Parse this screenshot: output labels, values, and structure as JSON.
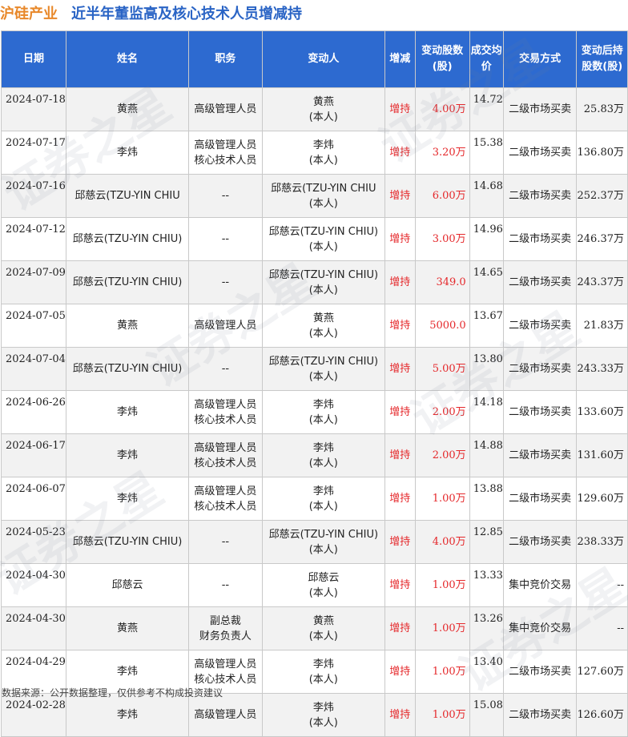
{
  "header": {
    "company": "沪硅产业",
    "title": "近半年董监高及核心技术人员增减持"
  },
  "columns": [
    "日期",
    "姓名",
    "职务",
    "变动人",
    "增减",
    "变动股数(股)",
    "成交均价",
    "交易方式",
    "变动后持股数(股)"
  ],
  "rows": [
    {
      "date": "2024-07-18",
      "name": "黄燕",
      "role": [
        "高级管理人员"
      ],
      "changer": [
        "黄燕",
        "(本人)"
      ],
      "dir": "增持",
      "amount": "4.00万",
      "price": "14.72",
      "method": "二级市场买卖",
      "after": "25.83万"
    },
    {
      "date": "2024-07-17",
      "name": "李炜",
      "role": [
        "高级管理人员",
        "核心技术人员"
      ],
      "changer": [
        "李炜",
        "(本人)"
      ],
      "dir": "增持",
      "amount": "3.20万",
      "price": "15.38",
      "method": "二级市场买卖",
      "after": "136.80万"
    },
    {
      "date": "2024-07-16",
      "name": "邱慈云(TZU-YIN CHIU",
      "role": [
        "--"
      ],
      "changer": [
        "邱慈云(TZU-YIN CHIU",
        "(本人)"
      ],
      "dir": "增持",
      "amount": "6.00万",
      "price": "14.68",
      "method": "二级市场买卖",
      "after": "252.37万"
    },
    {
      "date": "2024-07-12",
      "name": "邱慈云(TZU-YIN CHIU)",
      "role": [
        "--"
      ],
      "changer": [
        "邱慈云(TZU-YIN CHIU)",
        "(本人)"
      ],
      "dir": "增持",
      "amount": "3.00万",
      "price": "14.96",
      "method": "二级市场买卖",
      "after": "246.37万"
    },
    {
      "date": "2024-07-09",
      "name": "邱慈云(TZU-YIN CHIU)",
      "role": [
        "--"
      ],
      "changer": [
        "邱慈云(TZU-YIN CHIU)",
        "(本人)"
      ],
      "dir": "增持",
      "amount": "349.0",
      "price": "14.65",
      "method": "二级市场买卖",
      "after": "243.37万"
    },
    {
      "date": "2024-07-05",
      "name": "黄燕",
      "role": [
        "高级管理人员"
      ],
      "changer": [
        "黄燕",
        "(本人)"
      ],
      "dir": "增持",
      "amount": "5000.0",
      "price": "13.67",
      "method": "二级市场买卖",
      "after": "21.83万"
    },
    {
      "date": "2024-07-04",
      "name": "邱慈云(TZU-YIN CHIU)",
      "role": [
        "--"
      ],
      "changer": [
        "邱慈云(TZU-YIN CHIU)",
        "(本人)"
      ],
      "dir": "增持",
      "amount": "5.00万",
      "price": "13.80",
      "method": "二级市场买卖",
      "after": "243.33万"
    },
    {
      "date": "2024-06-26",
      "name": "李炜",
      "role": [
        "高级管理人员",
        "核心技术人员"
      ],
      "changer": [
        "李炜",
        "(本人)"
      ],
      "dir": "增持",
      "amount": "2.00万",
      "price": "14.18",
      "method": "二级市场买卖",
      "after": "133.60万"
    },
    {
      "date": "2024-06-17",
      "name": "李炜",
      "role": [
        "高级管理人员",
        "核心技术人员"
      ],
      "changer": [
        "李炜",
        "(本人)"
      ],
      "dir": "增持",
      "amount": "2.00万",
      "price": "14.88",
      "method": "二级市场买卖",
      "after": "131.60万"
    },
    {
      "date": "2024-06-07",
      "name": "李炜",
      "role": [
        "高级管理人员",
        "核心技术人员"
      ],
      "changer": [
        "李炜",
        "(本人)"
      ],
      "dir": "增持",
      "amount": "1.00万",
      "price": "13.88",
      "method": "二级市场买卖",
      "after": "129.60万"
    },
    {
      "date": "2024-05-23",
      "name": "邱慈云(TZU-YIN CHIU)",
      "role": [
        "--"
      ],
      "changer": [
        "邱慈云(TZU-YIN CHIU)",
        "(本人)"
      ],
      "dir": "增持",
      "amount": "4.00万",
      "price": "12.85",
      "method": "二级市场买卖",
      "after": "238.33万"
    },
    {
      "date": "2024-04-30",
      "name": "邱慈云",
      "role": [
        "--"
      ],
      "changer": [
        "邱慈云",
        "(本人)"
      ],
      "dir": "增持",
      "amount": "1.00万",
      "price": "13.33",
      "method": "集中竞价交易",
      "after": "--"
    },
    {
      "date": "2024-04-30",
      "name": "黄燕",
      "role": [
        "副总裁",
        "财务负责人"
      ],
      "changer": [
        "黄燕",
        "(本人)"
      ],
      "dir": "增持",
      "amount": "1.00万",
      "price": "13.26",
      "method": "集中竞价交易",
      "after": "--"
    },
    {
      "date": "2024-04-29",
      "name": "李炜",
      "role": [
        "高级管理人员",
        "核心技术人员"
      ],
      "changer": [
        "李炜",
        "(本人)"
      ],
      "dir": "增持",
      "amount": "1.00万",
      "price": "13.40",
      "method": "二级市场买卖",
      "after": "127.60万"
    },
    {
      "date": "2024-02-28",
      "name": "李炜",
      "role": [
        "高级管理人员"
      ],
      "changer": [
        "李炜",
        "(本人)"
      ],
      "dir": "增持",
      "amount": "1.00万",
      "price": "15.08",
      "method": "二级市场买卖",
      "after": "126.60万"
    }
  ],
  "footer": "数据来源：公开数据整理，仅供参考不构成投资建议",
  "watermark": "证券之星",
  "colors": {
    "header_bg": "#2d6ad0",
    "accent_red": "#e5282b",
    "company": "#e8882a",
    "title": "#2a64c5"
  }
}
